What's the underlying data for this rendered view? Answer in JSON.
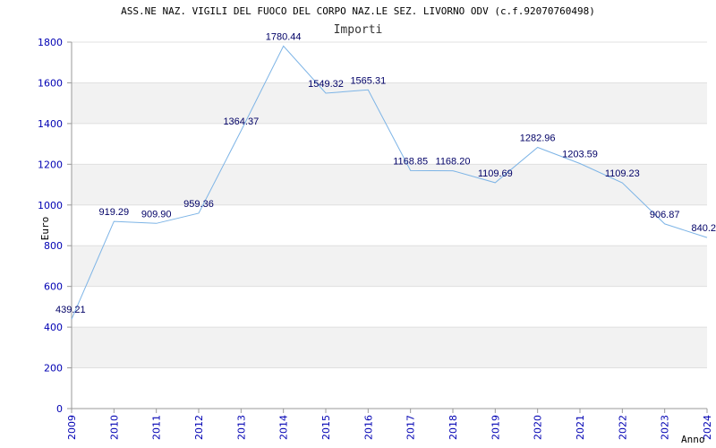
{
  "title": "ASS.NE NAZ. VIGILI DEL FUOCO DEL CORPO NAZ.LE SEZ. LIVORNO ODV (c.f.92070760498)",
  "subtitle": "Importi",
  "chart_data": {
    "type": "line",
    "x": [
      2009,
      2010,
      2011,
      2012,
      2013,
      2014,
      2015,
      2016,
      2017,
      2018,
      2019,
      2020,
      2021,
      2022,
      2023,
      2024
    ],
    "values": [
      439.21,
      919.29,
      909.9,
      959.36,
      1364.37,
      1780.44,
      1549.32,
      1565.31,
      1168.85,
      1168.2,
      1109.69,
      1282.96,
      1203.59,
      1109.23,
      906.87,
      840.2
    ],
    "value_labels": [
      "439.21",
      "919.29",
      "909.90",
      "959.36",
      "1364.37",
      "1780.44",
      "1549.32",
      "1565.31",
      "1168.85",
      "1168.20",
      "1109.69",
      "1282.96",
      "1203.59",
      "1109.23",
      "906.87",
      "840.2"
    ],
    "xlabel": "Anno",
    "ylabel": "Euro",
    "ylim": [
      0,
      1800
    ],
    "yticks": [
      0,
      200,
      400,
      600,
      800,
      1000,
      1200,
      1400,
      1600,
      1800
    ],
    "grid": true,
    "colors": {
      "line": "#7db4e6",
      "band": "#f2f2f2",
      "tick": "#0000b3",
      "label": "#000066",
      "axis": "#999999"
    }
  }
}
